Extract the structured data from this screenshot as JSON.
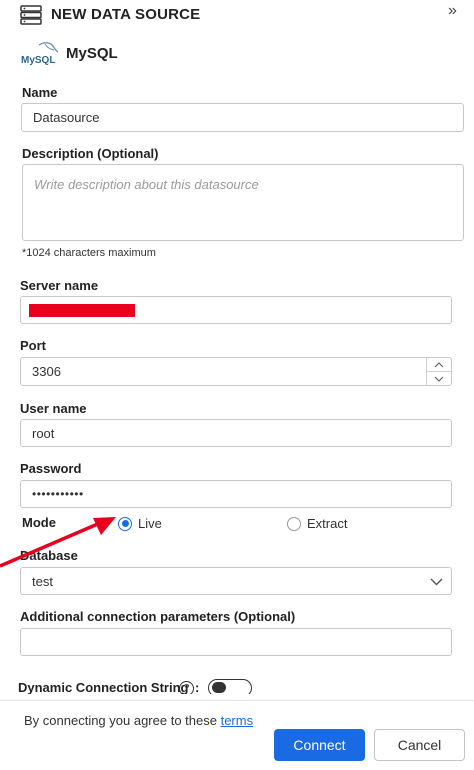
{
  "header": {
    "title": "NEW DATA SOURCE",
    "collapse_symbol": "»"
  },
  "provider": {
    "logo_text": "MySQL",
    "name": "MySQL"
  },
  "form": {
    "name": {
      "label": "Name",
      "value": "Datasource"
    },
    "description": {
      "label": "Description (Optional)",
      "placeholder": "Write description about this datasource",
      "hint": "*1024 characters maximum"
    },
    "server": {
      "label": "Server name",
      "value_redacted": true
    },
    "port": {
      "label": "Port",
      "value": "3306"
    },
    "username": {
      "label": "User name",
      "value": "root"
    },
    "password": {
      "label": "Password",
      "masked": "•••••••••••"
    },
    "mode": {
      "label": "Mode",
      "options": [
        {
          "label": "Live",
          "selected": true
        },
        {
          "label": "Extract",
          "selected": false
        }
      ]
    },
    "database": {
      "label": "Database",
      "value": "test"
    },
    "additional": {
      "label": "Additional connection parameters (Optional)",
      "value": ""
    },
    "dynamic": {
      "label": "Dynamic Connection String",
      "help_symbol": "?",
      "colon": ":",
      "enabled": false
    }
  },
  "footer": {
    "agreement_text": "By connecting you agree to these ",
    "terms_link": "terms",
    "connect_label": "Connect",
    "cancel_label": "Cancel"
  },
  "colors": {
    "accent": "#1a6ae3",
    "redaction": "#e8001c",
    "annotation_arrow": "#e8001c"
  },
  "icons": [
    "datasource-icon",
    "collapse-icon",
    "mysql-logo",
    "chevron-up-icon",
    "chevron-down-icon",
    "help-icon",
    "annotation-arrow"
  ]
}
